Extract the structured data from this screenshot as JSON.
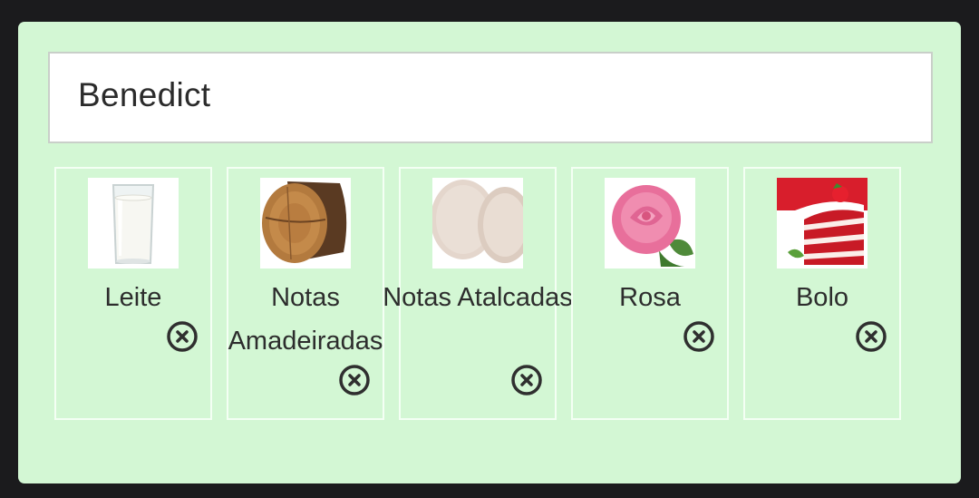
{
  "name_field": {
    "value": "Benedict"
  },
  "items": [
    {
      "label": "Leite",
      "image": "milk-glass",
      "remove_icon": "close-circle-icon"
    },
    {
      "label": "Notas Amadeiradas",
      "image": "wood-log",
      "remove_icon": "close-circle-icon"
    },
    {
      "label": "Notas Atalcadas",
      "image": "powder-compact",
      "remove_icon": "close-circle-icon"
    },
    {
      "label": "Rosa",
      "image": "pink-rose",
      "remove_icon": "close-circle-icon"
    },
    {
      "label": "Bolo",
      "image": "red-velvet-cake",
      "remove_icon": "close-circle-icon"
    }
  ],
  "colors": {
    "panel": "#d3f7d4",
    "background": "#1b1b1d",
    "text": "#2d2d2d"
  }
}
